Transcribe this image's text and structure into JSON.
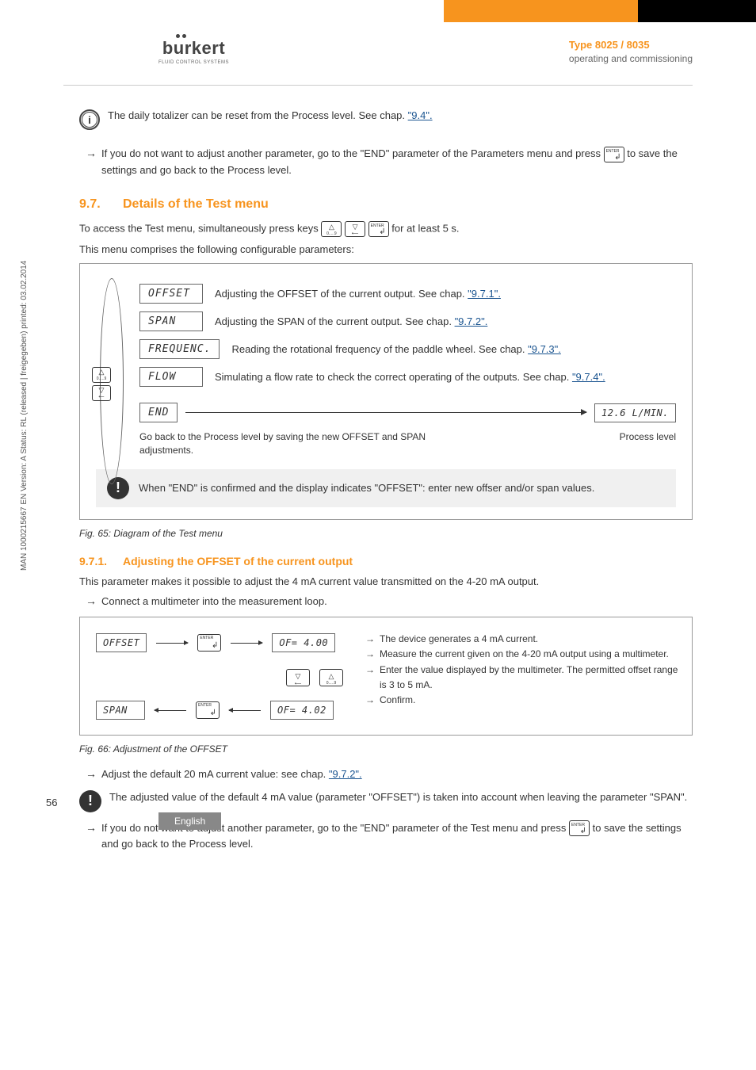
{
  "header": {
    "logo_main": "burkert",
    "logo_sub": "FLUID CONTROL SYSTEMS",
    "type": "Type 8025 / 8035",
    "subtitle": "operating and commissioning"
  },
  "info_note": "The daily totalizer can be reset from the Process level. See chap. ",
  "info_note_link": "\"9.4\".",
  "end_param_text_1": "If you do not want to adjust another parameter, go to the \"END\" parameter of the Parameters menu and press ",
  "end_param_text_2": " to save the settings and go back to the Process level.",
  "section_9_7": {
    "num": "9.7.",
    "title": "Details of the Test menu",
    "intro_1": "To access the Test menu, simultaneously press keys ",
    "intro_2": " for at least 5 s.",
    "intro_3": "This menu comprises the following configurable parameters:"
  },
  "menu": {
    "offset": {
      "label": "OFFSET",
      "desc": "Adjusting the OFFSET of the current output. See chap. ",
      "link": "\"9.7.1\"."
    },
    "span": {
      "label": "SPAN",
      "desc": "Adjusting the SPAN of the current output. See chap. ",
      "link": "\"9.7.2\"."
    },
    "frequenc": {
      "label": "FREQUENC.",
      "desc": "Reading the rotational frequency of the paddle wheel. See chap. ",
      "link": "\"9.7.3\"."
    },
    "flow": {
      "label": "FLOW",
      "desc": "Simulating a flow rate to check the correct operating of the outputs. See chap. ",
      "link": "\"9.7.4\"."
    },
    "end": {
      "label": "END",
      "process": "12.6 L/MIN.",
      "desc": "Go back to the Process level by saving the new OFFSET and SPAN adjustments.",
      "process_level": "Process level"
    },
    "warn": "When \"END\" is confirmed and the display indicates \"OFFSET\": enter new offser and/or span values."
  },
  "fig65": "Fig. 65:   Diagram of the Test menu",
  "section_9_7_1": {
    "num": "9.7.1.",
    "title": "Adjusting the OFFSET of the current output",
    "intro": "This parameter makes it possible to adjust the 4 mA current value transmitted on the 4-20 mA output.",
    "step1": "Connect a multimeter into the measurement loop."
  },
  "offset_diag": {
    "box_offset": "OFFSET",
    "box_of400": "OF= 4.00",
    "box_span": "SPAN",
    "box_of402": "OF= 4.02",
    "s1": "The device generates a 4 mA current.",
    "s2": "Measure the current given on the 4-20 mA output using a multimeter.",
    "s3": "Enter the value displayed by the multimeter. The permitted offset range is 3 to 5 mA.",
    "s4": "Confirm."
  },
  "fig66": "Fig. 66:   Adjustment of the OFFSET",
  "adjust_20": "Adjust the default 20 mA current value: see chap. ",
  "adjust_20_link": "\"9.7.2\".",
  "warn_span": "The adjusted value of the default 4 mA value (parameter \"OFFSET\") is taken into account when leaving the parameter \"SPAN\".",
  "end_test_1": "If you do not want to adjust another parameter, go to the \"END\" parameter of the Test menu and press ",
  "end_test_2": " to save the settings and go back to the Process level.",
  "sidebar": "MAN 1000215667 EN Version: A Status: RL (released | freigegeben) printed: 03.02.2014",
  "page_num": "56",
  "footer_lang": "English"
}
